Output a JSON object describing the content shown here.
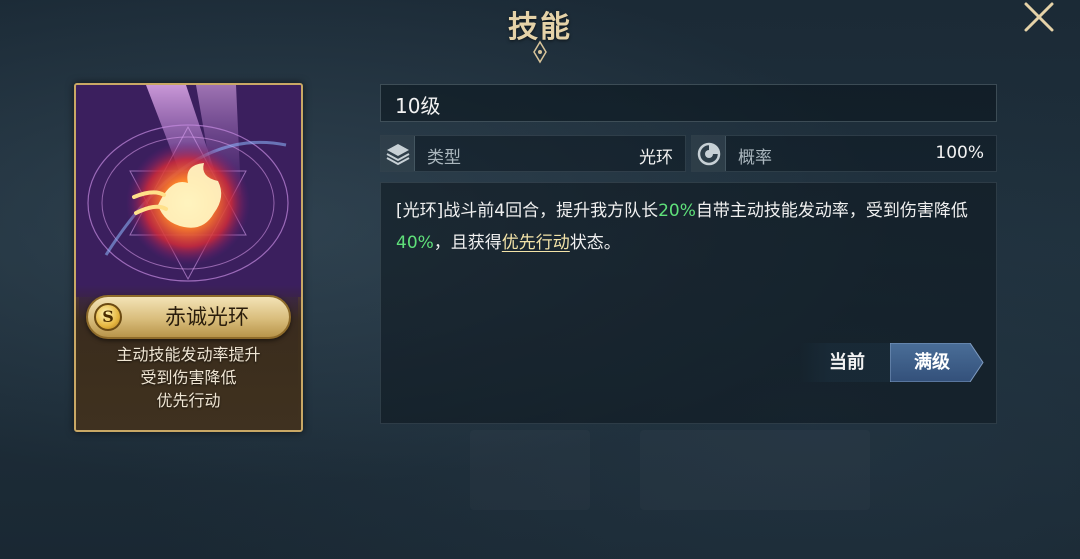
{
  "header": {
    "title": "技能",
    "close_icon": "close-x-icon"
  },
  "skill_card": {
    "grade": "S",
    "name": "赤诚光环",
    "art_icon": "flame-aura-emblem-icon",
    "effects": [
      "主动技能发动率提升",
      "受到伤害降低",
      "优先行动"
    ]
  },
  "detail": {
    "level": "10级",
    "stats": [
      {
        "icon": "layers-icon",
        "label": "类型",
        "value": "光环"
      },
      {
        "icon": "pie-chart-icon",
        "label": "概率",
        "value": "100%"
      }
    ],
    "description": {
      "p1": "[光环]战斗前4回合，提升我方队长",
      "v1": "20%",
      "p2": "自带主动技能发动率，受到伤害降低",
      "v2": "40%",
      "p3": "，且获得",
      "link": "优先行动",
      "p4": "状态。"
    },
    "level_toggle": {
      "current_label": "当前",
      "max_label": "满级",
      "selected": "满级"
    }
  },
  "colors": {
    "accent_gold": "#e5d2a8",
    "highlight_green": "#5fe07a",
    "toggle_selected": "#3f5f86"
  }
}
